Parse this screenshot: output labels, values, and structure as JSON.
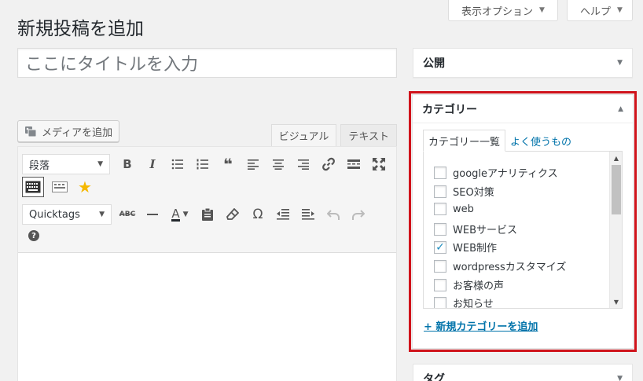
{
  "screen_options": {
    "label": "表示オプション"
  },
  "help": {
    "label": "ヘルプ"
  },
  "page_title": "新規投稿を追加",
  "title_field": {
    "placeholder": "ここにタイトルを入力"
  },
  "media_button": {
    "label": "メディアを追加"
  },
  "editor_tabs": {
    "visual": "ビジュアル",
    "text": "テキスト"
  },
  "toolbar": {
    "format_select": "段落",
    "quicktags_select": "Quicktags",
    "bold": "B",
    "italic": "I",
    "quote": "❝",
    "omega": "Ω",
    "help": "?",
    "strike": "ABC",
    "text_color": "A"
  },
  "publish_box": {
    "title": "公開"
  },
  "category_box": {
    "title": "カテゴリー",
    "tab_all": "カテゴリー一覧",
    "tab_popular": "よく使うもの",
    "items": [
      {
        "label": "googleアナリティクス",
        "checked": false
      },
      {
        "label": "SEO対策",
        "checked": false
      },
      {
        "label": "web",
        "checked": false
      },
      {
        "label": "WEBサービス",
        "checked": false
      },
      {
        "label": "WEB制作",
        "checked": true
      },
      {
        "label": "wordpressカスタマイズ",
        "checked": false
      },
      {
        "label": "お客様の声",
        "checked": false
      },
      {
        "label": "お知らせ",
        "checked": false
      }
    ],
    "add_link": "+ 新規カテゴリーを追加"
  },
  "tag_box": {
    "title": "タグ"
  },
  "colors": {
    "highlight": "#d0131b",
    "link": "#0073aa",
    "star": "#f5b800"
  }
}
